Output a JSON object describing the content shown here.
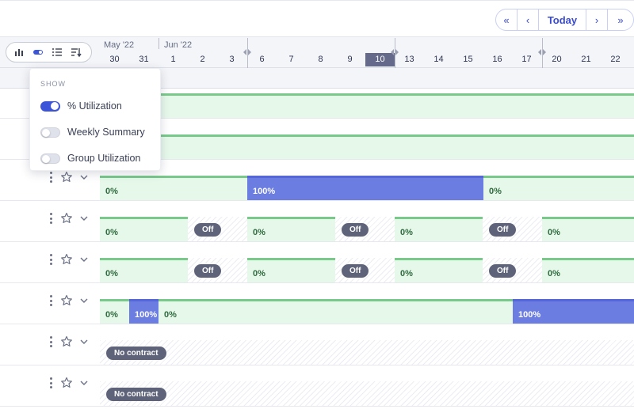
{
  "nav": {
    "first": "«",
    "prev": "‹",
    "today": "Today",
    "next": "›",
    "last": "»"
  },
  "view_toggle": [
    "bar-chart-icon",
    "toggle-icon",
    "list-icon",
    "sort-icon"
  ],
  "months": [
    {
      "label": "May '22"
    },
    {
      "label": "Jun '22"
    }
  ],
  "days": [
    "30",
    "31",
    "1",
    "2",
    "3",
    "6",
    "7",
    "8",
    "9",
    "10",
    "13",
    "14",
    "15",
    "16",
    "17",
    "20",
    "21",
    "22"
  ],
  "selected_day": "10",
  "popover": {
    "header": "SHOW",
    "options": [
      {
        "label": "% Utilization",
        "on": true
      },
      {
        "label": "Weekly Summary",
        "on": false
      },
      {
        "label": "Group Utilization",
        "on": false
      }
    ]
  },
  "rows": [
    {
      "segments": []
    },
    {
      "segments": []
    },
    {
      "labels": [
        "0%",
        "100%",
        "0%"
      ]
    },
    {
      "labels": [
        "0%",
        "Off",
        "0%",
        "Off",
        "0%",
        "Off",
        "0%"
      ]
    },
    {
      "labels": [
        "0%",
        "Off",
        "0%",
        "Off",
        "0%",
        "Off",
        "0%"
      ]
    },
    {
      "labels": [
        "0%",
        "100%",
        "0%",
        "100%"
      ]
    },
    {
      "labels": [
        "No contract"
      ]
    },
    {
      "labels": [
        "No contract"
      ]
    }
  ],
  "colors": {
    "accent": "#3a4bd1",
    "utilization_green": "#79c98b",
    "booked_blue": "#6b7de0"
  }
}
